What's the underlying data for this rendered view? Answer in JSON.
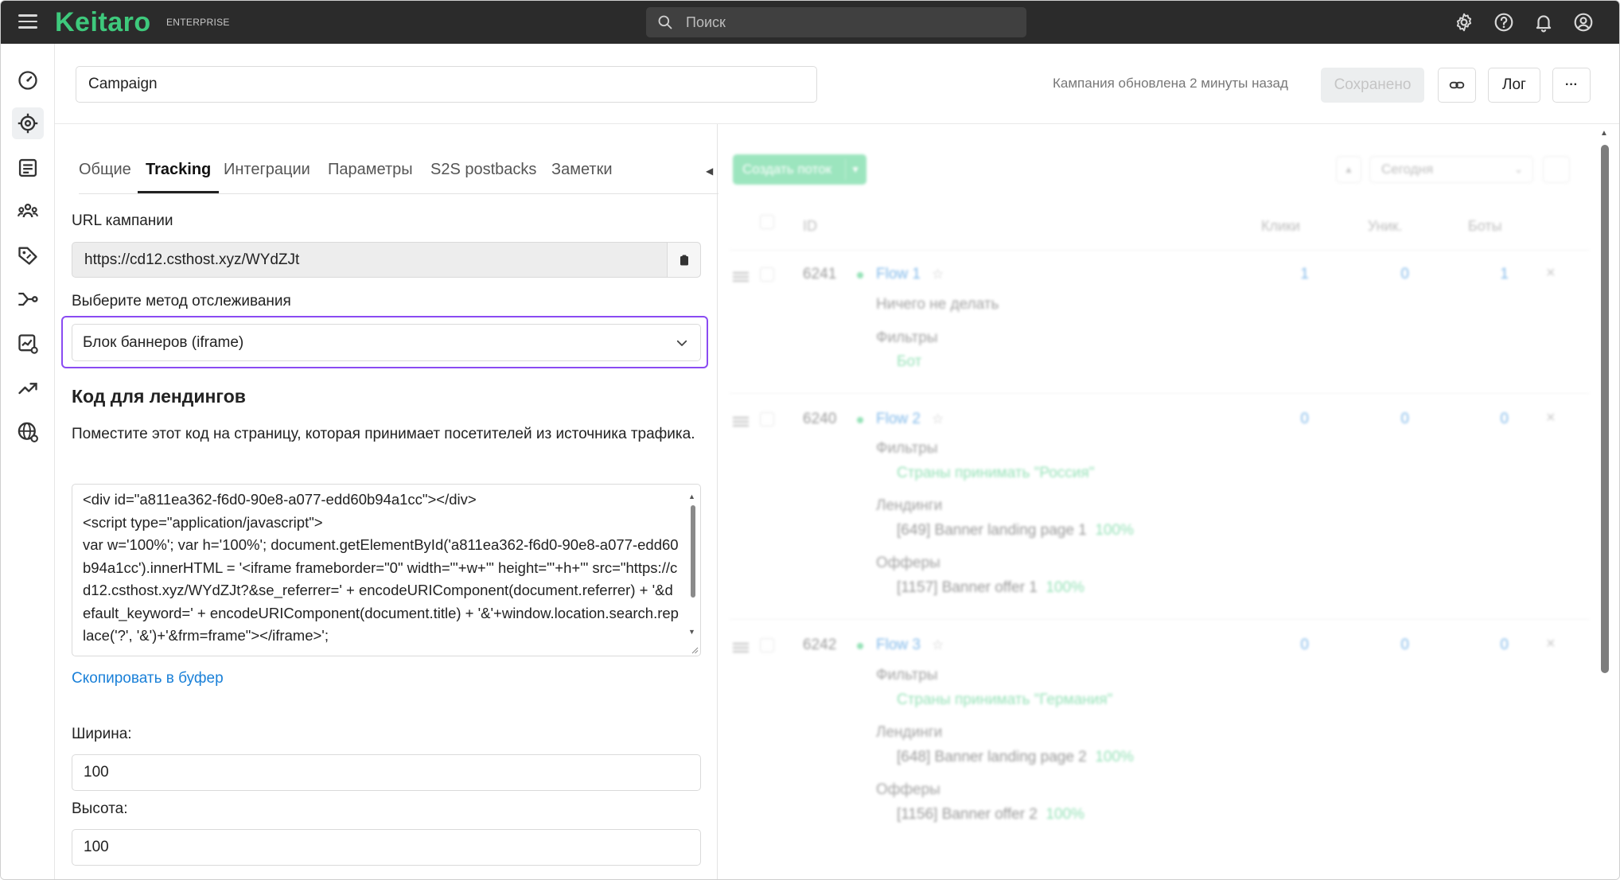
{
  "app": {
    "brand": "Keitaro",
    "edition": "ENTERPRISE",
    "search_placeholder": "Поиск"
  },
  "topbar_icons": [
    "gear-icon",
    "help-icon",
    "bell-icon",
    "user-icon"
  ],
  "rail_icons": [
    "dashboard-icon",
    "campaigns-icon",
    "landings-icon",
    "affiliate-networks-icon",
    "offers-icon",
    "flows-icon",
    "reports-icon",
    "trends-icon",
    "domains-icon"
  ],
  "header": {
    "campaign_name": "Campaign",
    "updated_text": "Кампания обновлена 2 минуты назад",
    "saved_label": "Сохранено",
    "log_label": "Лог",
    "more_label": "···"
  },
  "tabs": [
    {
      "label": "Общие"
    },
    {
      "label": "Tracking"
    },
    {
      "label": "Интеграции"
    },
    {
      "label": "Параметры"
    },
    {
      "label": "S2S postbacks"
    },
    {
      "label": "Заметки"
    }
  ],
  "tracking": {
    "url_label": "URL кампании",
    "url_value": "https://cd12.csthost.xyz/WYdZJt",
    "method_label": "Выберите метод отслеживания",
    "method_value": "Блок баннеров (iframe)",
    "code_heading": "Код для лендингов",
    "code_description": "Поместите этот код на страницу, которая принимает посетителей из источника трафика.",
    "code": "<div id=\"a811ea362-f6d0-90e8-a077-edd60b94a1cc\"></div>\n<script type=\"application/javascript\">\nvar w='100%'; var h='100%'; document.getElementById('a811ea362-f6d0-90e8-a077-edd60b94a1cc').innerHTML = '<iframe frameborder=\"0\" width=\"'+w+'\" height=\"'+h+'\" src=\"https://cd12.csthost.xyz/WYdZJt?&se_referrer=' + encodeURIComponent(document.referrer) + '&default_keyword=' + encodeURIComponent(document.title) + '&'+window.location.search.replace('?', '&')+'&frm=frame\"></iframe>';",
    "copy_link": "Скопировать в буфер",
    "width_label": "Ширина:",
    "width_value": "100",
    "height_label": "Высота:",
    "height_value": "100"
  },
  "flows_panel": {
    "create_button": "Создать поток",
    "date_filter": "Сегодня",
    "columns": {
      "id": "ID",
      "clicks": "Клики",
      "unique": "Уник.",
      "bots": "Боты"
    },
    "flows": [
      {
        "id": "6241",
        "name": "Flow 1",
        "clicks": "1",
        "unique": "0",
        "bots": "1",
        "action": "Ничего не делать",
        "filters_label": "Фильтры",
        "filter": "Бот"
      },
      {
        "id": "6240",
        "name": "Flow 2",
        "clicks": "0",
        "unique": "0",
        "bots": "0",
        "filters_label": "Фильтры",
        "filter": "Страны принимать \"Россия\"",
        "landings_label": "Лендинги",
        "landing": "[649] Banner landing page 1",
        "landing_share": "100%",
        "offers_label": "Офферы",
        "offer": "[1157] Banner offer 1",
        "offer_share": "100%"
      },
      {
        "id": "6242",
        "name": "Flow 3",
        "clicks": "0",
        "unique": "0",
        "bots": "0",
        "filters_label": "Фильтры",
        "filter": "Страны принимать \"Германия\"",
        "landings_label": "Лендинги",
        "landing": "[648] Banner landing page 2",
        "landing_share": "100%",
        "offers_label": "Офферы",
        "offer": "[1156] Banner offer 2",
        "offer_share": "100%"
      }
    ]
  },
  "colors": {
    "brand_green": "#3ec97c",
    "topbar_bg": "#2b2b2b",
    "highlight": "#8a4bf2",
    "link_blue": "#1a80d8"
  }
}
